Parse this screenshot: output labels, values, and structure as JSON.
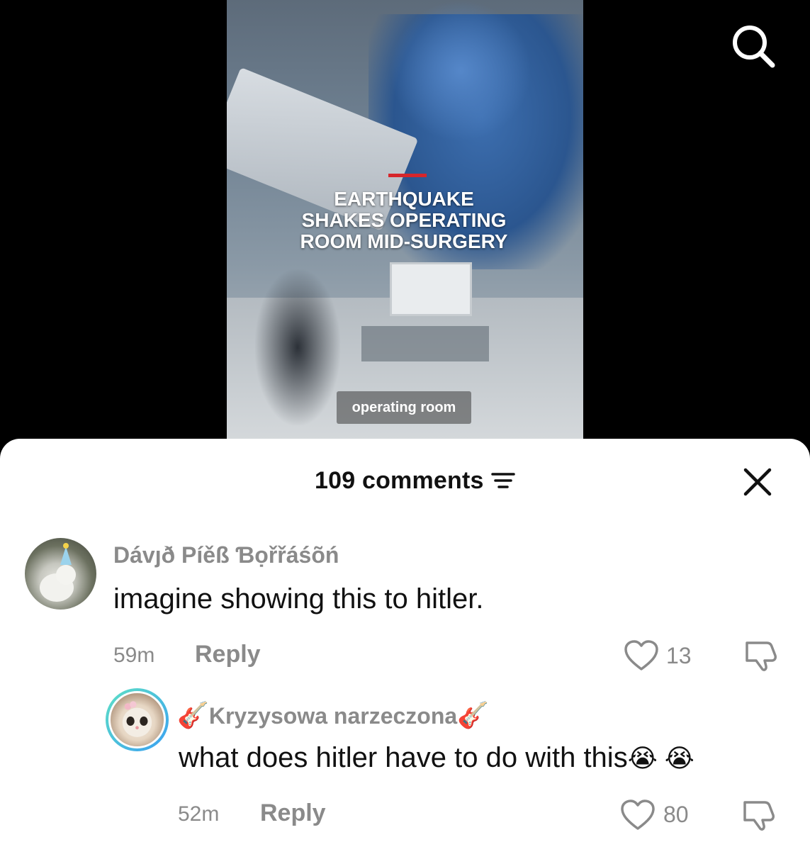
{
  "video": {
    "headline": "EARTHQUAKE\nSHAKES OPERATING\nROOM MID-SURGERY",
    "caption": "operating room",
    "accent_color": "#d6262b",
    "search_icon": "search-icon"
  },
  "comments_sheet": {
    "count_label": "109 comments",
    "filter_icon": "sort-filter-icon",
    "close_icon": "close-icon"
  },
  "comments": [
    {
      "username": "Dávȷð Píěß Ɓọřřáśõń",
      "text": "imagine showing this to hitler.",
      "time": "59m",
      "reply_label": "Reply",
      "likes": "13"
    },
    {
      "username_prefix": "🎸",
      "username": "Kryzysowa narzeczona",
      "username_suffix": "🎸",
      "text": "what does hitler have to do with this",
      "emojis": "😭 😭",
      "time": "52m",
      "reply_label": "Reply",
      "likes": "80"
    }
  ]
}
